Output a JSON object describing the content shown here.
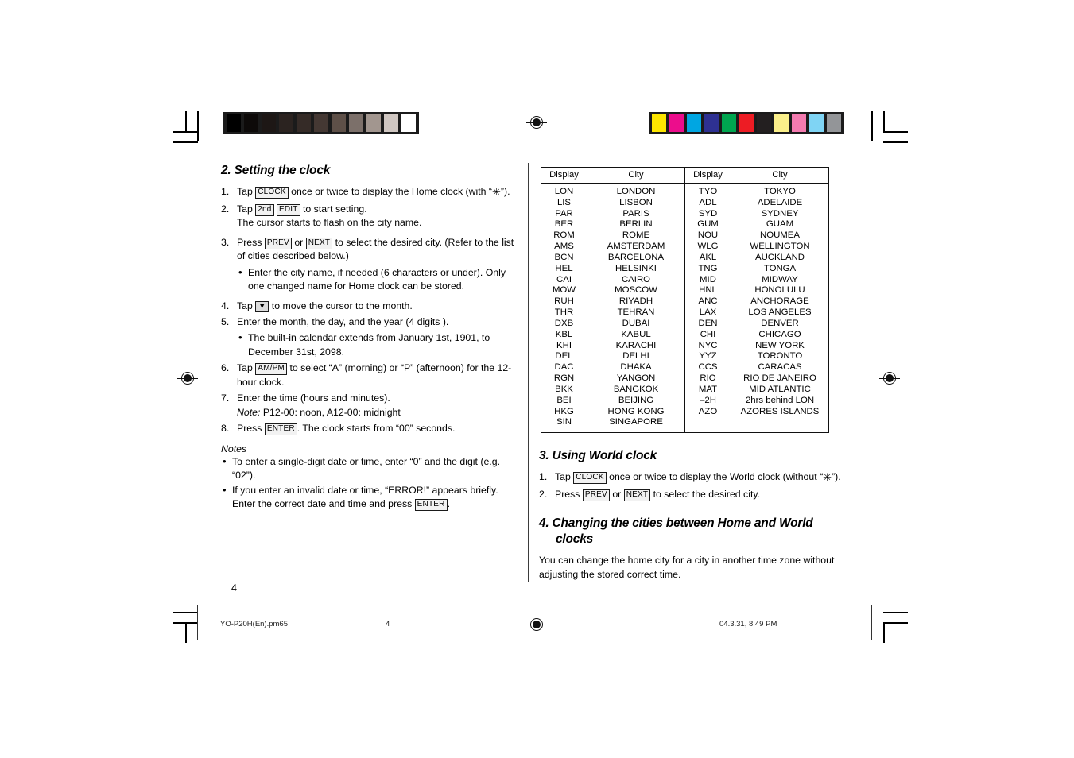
{
  "document": {
    "page_number": "4",
    "footer": {
      "filename": "YO-P20H(En).pm65",
      "page": "4",
      "timestamp": "04.3.31, 8:49 PM"
    }
  },
  "printer_marks": {
    "grayscale_bar": [
      "#000000",
      "#0d0a09",
      "#1d1715",
      "#2b2320",
      "#352b27",
      "#443833",
      "#5e5048",
      "#7c706a",
      "#a2968f",
      "#cfc6c1",
      "#ffffff"
    ],
    "color_bar": [
      "#fde600",
      "#ec0d8c",
      "#00a6e2",
      "#2e3192",
      "#00a650",
      "#ed1c24",
      "#231f20",
      "#faef8a",
      "#f徒",
      "#7fd4f4",
      "#939598"
    ],
    "color_bar_fixed": [
      "#fde600",
      "#ec0d8c",
      "#00a6e2",
      "#2e3192",
      "#00a650",
      "#ed1c24",
      "#231f20",
      "#faef8a",
      "#f craft",
      "#7fd4f4",
      "#939598"
    ]
  },
  "section2": {
    "heading_num": "2.",
    "heading_text": "Setting the clock",
    "steps": [
      {
        "n": "1.",
        "parts": [
          {
            "t": "text",
            "v": "Tap "
          },
          {
            "t": "key",
            "v": "CLOCK"
          },
          {
            "t": "text",
            "v": " once or twice to display the Home clock (with “"
          },
          {
            "t": "star",
            "v": "✳"
          },
          {
            "t": "text",
            "v": "”)."
          }
        ]
      },
      {
        "n": "2.",
        "parts": [
          {
            "t": "text",
            "v": "Tap "
          },
          {
            "t": "key",
            "v": "2nd"
          },
          {
            "t": "text",
            "v": " "
          },
          {
            "t": "key",
            "v": "EDIT"
          },
          {
            "t": "text",
            "v": " to start setting."
          },
          {
            "t": "break",
            "v": ""
          },
          {
            "t": "text",
            "v": "The cursor starts to flash on the city name."
          }
        ]
      },
      {
        "n": "3.",
        "parts": [
          {
            "t": "text",
            "v": "Press "
          },
          {
            "t": "key",
            "v": "PREV"
          },
          {
            "t": "text",
            "v": " or "
          },
          {
            "t": "key",
            "v": "NEXT"
          },
          {
            "t": "text",
            "v": " to select the desired city. (Refer to the list of cities described below.)"
          }
        ],
        "bullets": [
          "Enter the city name, if needed (6 characters or under). Only one changed name for Home clock can be stored."
        ]
      },
      {
        "n": "4.",
        "parts": [
          {
            "t": "text",
            "v": "Tap "
          },
          {
            "t": "arrowkey",
            "v": "▼"
          },
          {
            "t": "text",
            "v": " to move the cursor to the month."
          }
        ]
      },
      {
        "n": "5.",
        "parts": [
          {
            "t": "text",
            "v": "Enter the month, the day, and the year (4 digits )."
          }
        ],
        "bullets": [
          "The built-in calendar extends from January 1st, 1901, to December 31st, 2098."
        ]
      },
      {
        "n": "6.",
        "parts": [
          {
            "t": "text",
            "v": "Tap  "
          },
          {
            "t": "key",
            "v": "AM/PM"
          },
          {
            "t": "text",
            "v": " to select “A” (morning) or “P” (afternoon) for the 12-hour clock."
          }
        ]
      },
      {
        "n": "7.",
        "parts": [
          {
            "t": "text",
            "v": "Enter the time (hours and minutes)."
          },
          {
            "t": "break",
            "v": ""
          },
          {
            "t": "ital",
            "v": "Note:"
          },
          {
            "t": "text",
            "v": " P12-00: noon, A12-00: midnight"
          }
        ]
      },
      {
        "n": "8.",
        "parts": [
          {
            "t": "text",
            "v": "Press "
          },
          {
            "t": "key",
            "v": "ENTER"
          },
          {
            "t": "text",
            "v": ". The clock starts from “00” seconds."
          }
        ]
      }
    ],
    "notes_label": "Notes",
    "notes": [
      {
        "parts": [
          {
            "t": "text",
            "v": "To enter a single-digit date or time, enter “0” and the digit (e.g. “02”)."
          }
        ]
      },
      {
        "parts": [
          {
            "t": "text",
            "v": "If you enter an invalid date or time, “ERROR!”  appears briefly. Enter the correct date and time and press "
          },
          {
            "t": "key",
            "v": "ENTER"
          },
          {
            "t": "text",
            "v": "."
          }
        ]
      }
    ]
  },
  "city_table": {
    "headers": [
      "Display",
      "City",
      "Display",
      "City"
    ],
    "rows": [
      [
        "LON",
        "LONDON",
        "TYO",
        "TOKYO"
      ],
      [
        "LIS",
        "LISBON",
        "ADL",
        "ADELAIDE"
      ],
      [
        "PAR",
        "PARIS",
        "SYD",
        "SYDNEY"
      ],
      [
        "BER",
        "BERLIN",
        "GUM",
        "GUAM"
      ],
      [
        "ROM",
        "ROME",
        "NOU",
        "NOUMEA"
      ],
      [
        "AMS",
        "AMSTERDAM",
        "WLG",
        "WELLINGTON"
      ],
      [
        "BCN",
        "BARCELONA",
        "AKL",
        "AUCKLAND"
      ],
      [
        "HEL",
        "HELSINKI",
        "TNG",
        "TONGA"
      ],
      [
        "CAI",
        "CAIRO",
        "MID",
        "MIDWAY"
      ],
      [
        "MOW",
        "MOSCOW",
        "HNL",
        "HONOLULU"
      ],
      [
        "RUH",
        "RIYADH",
        "ANC",
        "ANCHORAGE"
      ],
      [
        "THR",
        "TEHRAN",
        "LAX",
        "LOS ANGELES"
      ],
      [
        "DXB",
        "DUBAI",
        "DEN",
        "DENVER"
      ],
      [
        "KBL",
        "KABUL",
        "CHI",
        "CHICAGO"
      ],
      [
        "KHI",
        "KARACHI",
        "NYC",
        "NEW YORK"
      ],
      [
        "DEL",
        "DELHI",
        "YYZ",
        "TORONTO"
      ],
      [
        "DAC",
        "DHAKA",
        "CCS",
        "CARACAS"
      ],
      [
        "RGN",
        "YANGON",
        "RIO",
        "RIO DE JANEIRO"
      ],
      [
        "BKK",
        "BANGKOK",
        "MAT",
        "MID ATLANTIC"
      ],
      [
        "BEI",
        "BEIJING",
        "–2H",
        "2hrs behind LON"
      ],
      [
        "HKG",
        "HONG KONG",
        "AZO",
        "AZORES ISLANDS"
      ],
      [
        "SIN",
        "SINGAPORE",
        "",
        ""
      ]
    ]
  },
  "section3": {
    "heading_num": "3.",
    "heading_text": "Using World clock",
    "steps": [
      {
        "n": "1.",
        "parts": [
          {
            "t": "text",
            "v": "Tap "
          },
          {
            "t": "key",
            "v": "CLOCK"
          },
          {
            "t": "text",
            "v": " once or twice to display the World clock (without “"
          },
          {
            "t": "star",
            "v": "✳"
          },
          {
            "t": "text",
            "v": "”)."
          }
        ]
      },
      {
        "n": "2.",
        "parts": [
          {
            "t": "text",
            "v": "Press "
          },
          {
            "t": "key",
            "v": "PREV"
          },
          {
            "t": "text",
            "v": " or "
          },
          {
            "t": "key",
            "v": "NEXT"
          },
          {
            "t": "text",
            "v": " to select the desired city."
          }
        ]
      }
    ]
  },
  "section4": {
    "heading_num": "4.",
    "heading_text": "Changing the cities between Home and World clocks",
    "body": "You can change the home city for a city in another time zone without adjusting the stored correct time."
  }
}
